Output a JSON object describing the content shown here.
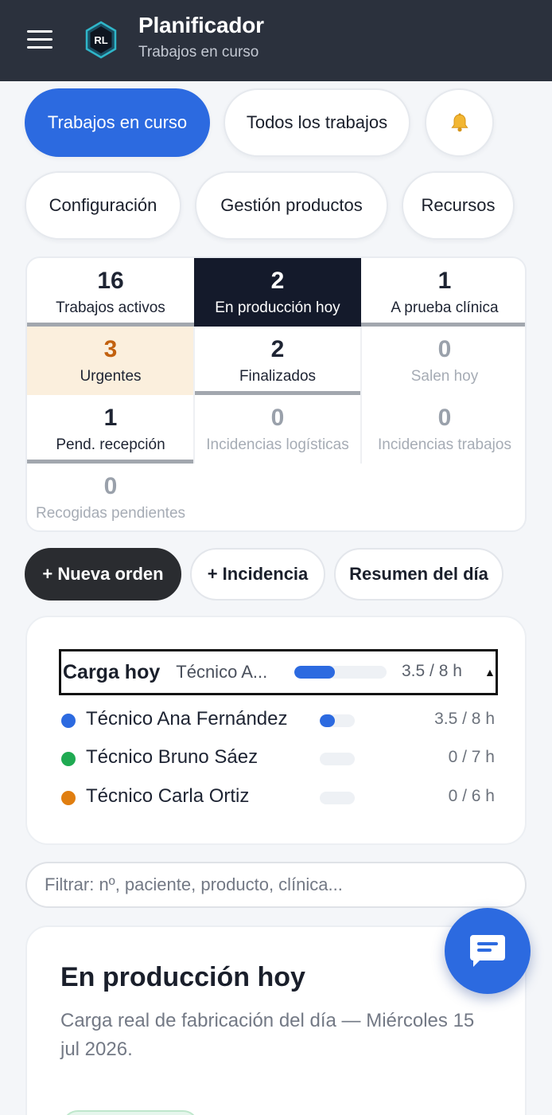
{
  "header": {
    "logo_text": "RL",
    "title": "Planificador",
    "subtitle": "Trabajos en curso"
  },
  "nav": {
    "trabajos_en_curso": "Trabajos en curso",
    "todos_los_trabajos": "Todos los trabajos",
    "configuracion": "Configuración",
    "gestion_productos": "Gestión productos",
    "recursos": "Recursos"
  },
  "stats": [
    {
      "value": "16",
      "label": "Trabajos activos"
    },
    {
      "value": "2",
      "label": "En producción hoy"
    },
    {
      "value": "1",
      "label": "A prueba clínica"
    },
    {
      "value": "3",
      "label": "Urgentes"
    },
    {
      "value": "2",
      "label": "Finalizados"
    },
    {
      "value": "0",
      "label": "Salen hoy"
    },
    {
      "value": "1",
      "label": "Pend. recepción"
    },
    {
      "value": "0",
      "label": "Incidencias logísticas"
    },
    {
      "value": "0",
      "label": "Incidencias trabajos"
    },
    {
      "value": "0",
      "label": "Recogidas pendientes"
    }
  ],
  "actions": {
    "nueva_orden": "+ Nueva orden",
    "incidencia": "+ Incidencia",
    "resumen": "Resumen del día"
  },
  "load": {
    "title": "Carga hoy",
    "summary_tech": "Técnico A...",
    "summary_hours": "3.5 / 8 h",
    "summary_fraction": 0.4375,
    "toggle": "▲",
    "techs": [
      {
        "name": "Técnico Ana Fernández",
        "hours": "3.5 / 8 h",
        "fraction": 0.4375,
        "color": "#2c6ae0"
      },
      {
        "name": "Técnico Bruno Sáez",
        "hours": "0 / 7 h",
        "fraction": 0,
        "color": "#1faa52"
      },
      {
        "name": "Técnico Carla Ortiz",
        "hours": "0 / 6 h",
        "fraction": 0,
        "color": "#e07e10"
      }
    ]
  },
  "filter": {
    "placeholder": "Filtrar: nº, paciente, producto, clínica..."
  },
  "production": {
    "title": "En producción hoy",
    "description": "Carga real de fabricación del día — Miércoles 15 jul 2026."
  },
  "colors": {
    "accent": "#2c6ae0",
    "header_bg": "#2b313d",
    "urgent": "#c2610f"
  },
  "icons": {
    "menu": "hamburger-icon",
    "bell": "bell-icon",
    "chat": "chat-icon"
  }
}
